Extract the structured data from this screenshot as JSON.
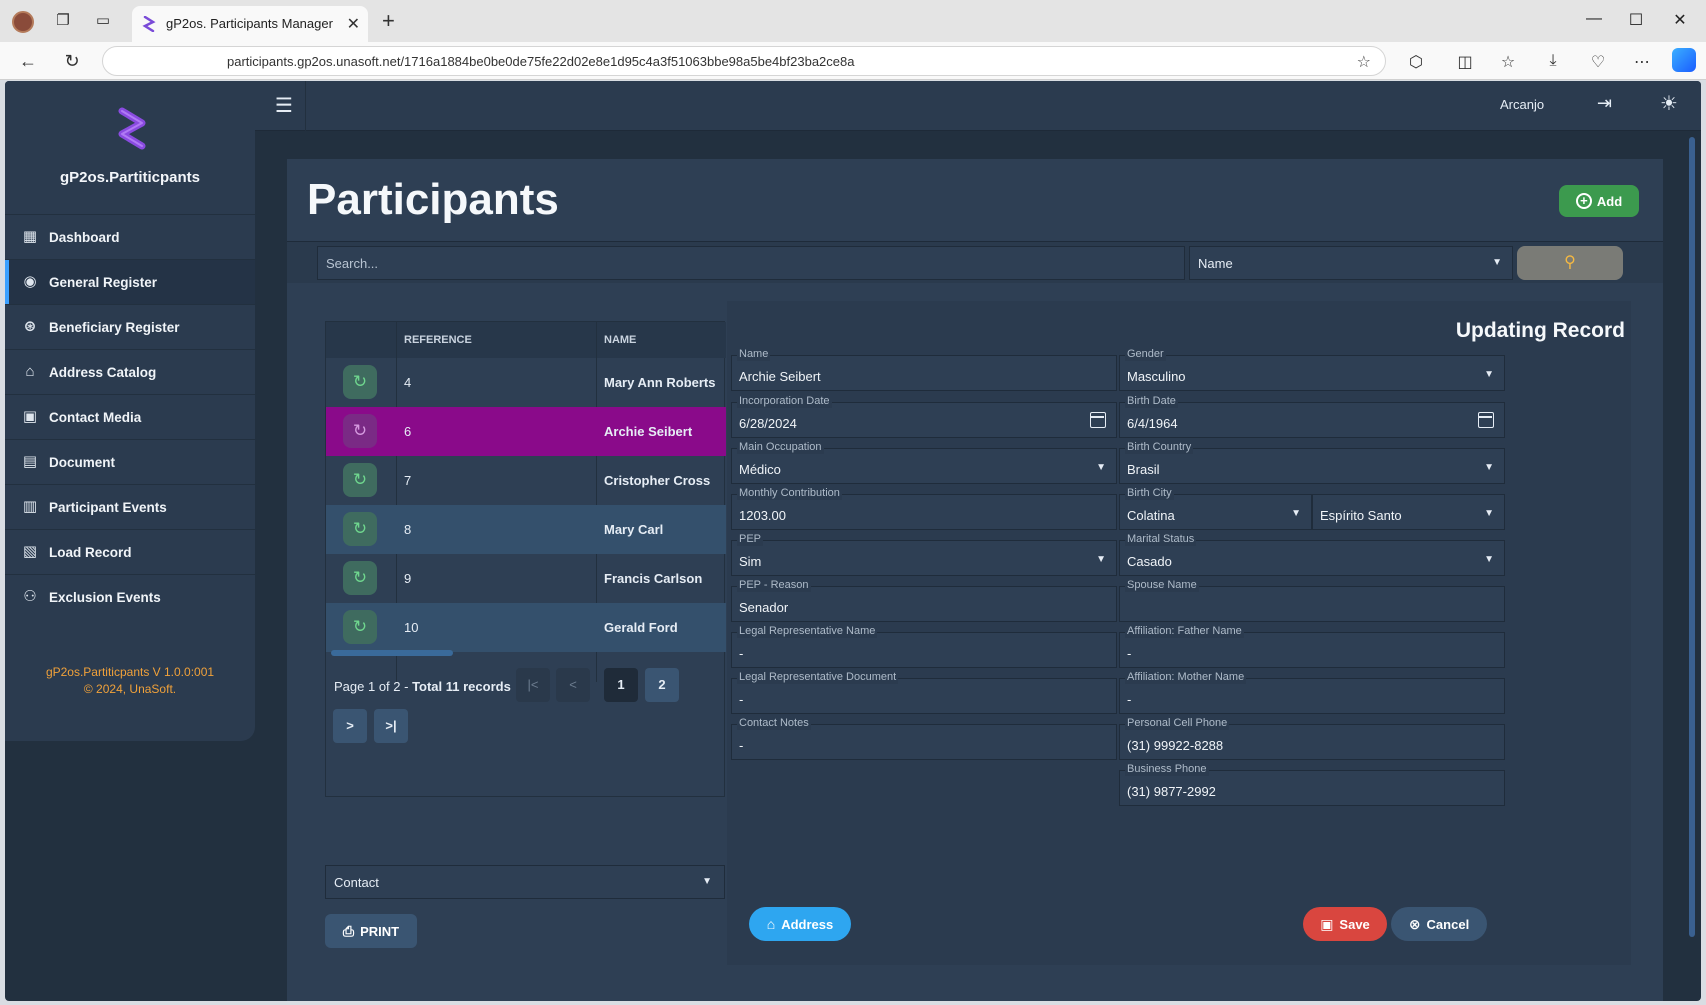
{
  "browser": {
    "tab_title": "gP2os. Participants Manager",
    "url": "participants.gp2os.unasoft.net/1716a1884be0be0de75fe22d02e8e1d95c4a3f51063bbe98a5be4bf23ba2ce8a"
  },
  "app": {
    "brand": "gP2os.Partiticpants",
    "user": "Arcanjo",
    "version_line1": "gP2os.Partiticpants V 1.0.0:001",
    "version_line2": "© 2024, UnaSoft.",
    "nav": [
      {
        "label": "Dashboard",
        "icon": "dashboard-icon"
      },
      {
        "label": "General Register",
        "icon": "user-circle-icon"
      },
      {
        "label": "Beneficiary Register",
        "icon": "beneficiary-icon"
      },
      {
        "label": "Address Catalog",
        "icon": "home-icon"
      },
      {
        "label": "Contact Media",
        "icon": "contact-card-icon"
      },
      {
        "label": "Document",
        "icon": "folder-icon"
      },
      {
        "label": "Participant Events",
        "icon": "events-icon"
      },
      {
        "label": "Load Record",
        "icon": "load-icon"
      },
      {
        "label": "Exclusion Events",
        "icon": "exclusion-icon"
      }
    ],
    "active_nav": "General Register"
  },
  "page": {
    "title": "Participants",
    "add_label": "Add",
    "search_placeholder": "Search...",
    "search_field": "Name"
  },
  "table": {
    "columns": [
      "",
      "REFERENCE",
      "NAME"
    ],
    "rows": [
      {
        "reference": "4",
        "name": "Mary Ann Roberts"
      },
      {
        "reference": "6",
        "name": "Archie Seibert"
      },
      {
        "reference": "7",
        "name": "Cristopher Cross"
      },
      {
        "reference": "8",
        "name": "Mary Carl"
      },
      {
        "reference": "9",
        "name": "Francis Carlson"
      },
      {
        "reference": "10",
        "name": "Gerald Ford"
      }
    ],
    "selected_reference": "6",
    "page_info": "Page 1 of 2 - ",
    "total_info": "Total 11 records",
    "pages": [
      "1",
      "2"
    ],
    "current_page": "1"
  },
  "lower": {
    "contact_select": "Contact",
    "print_label": "PRINT"
  },
  "form": {
    "title": "Updating Record",
    "name": {
      "label": "Name",
      "value": "Archie Seibert"
    },
    "gender": {
      "label": "Gender",
      "value": "Masculino"
    },
    "incorporation_date": {
      "label": "Incorporation Date",
      "value": "6/28/2024"
    },
    "birth_date": {
      "label": "Birth Date",
      "value": "6/4/1964"
    },
    "main_occupation": {
      "label": "Main Occupation",
      "value": "Médico"
    },
    "birth_country": {
      "label": "Birth Country",
      "value": "Brasil"
    },
    "monthly_contribution": {
      "label": "Monthly Contribution",
      "value": "1203.00"
    },
    "birth_city": {
      "label": "Birth City",
      "value": "Colatina"
    },
    "birth_state": {
      "value": "Espírito Santo"
    },
    "pep": {
      "label": "PEP",
      "value": "Sim"
    },
    "marital_status": {
      "label": "Marital Status",
      "value": "Casado"
    },
    "pep_reason": {
      "label": "PEP - Reason",
      "value": "Senador"
    },
    "spouse_name": {
      "label": "Spouse Name",
      "value": ""
    },
    "legal_rep_name": {
      "label": "Legal Representative Name",
      "value": "-"
    },
    "father_name": {
      "label": "Affiliation: Father Name",
      "value": "-"
    },
    "legal_rep_document": {
      "label": "Legal Representative Document",
      "value": "-"
    },
    "mother_name": {
      "label": "Affiliation: Mother Name",
      "value": "-"
    },
    "contact_notes": {
      "label": "Contact Notes",
      "value": "-"
    },
    "personal_cell": {
      "label": "Personal Cell Phone",
      "value": "(31) 99922-8288"
    },
    "business_phone": {
      "label": "Business Phone",
      "value": "(31) 9877-2992"
    },
    "address_label": "Address",
    "save_label": "Save",
    "cancel_label": "Cancel"
  }
}
